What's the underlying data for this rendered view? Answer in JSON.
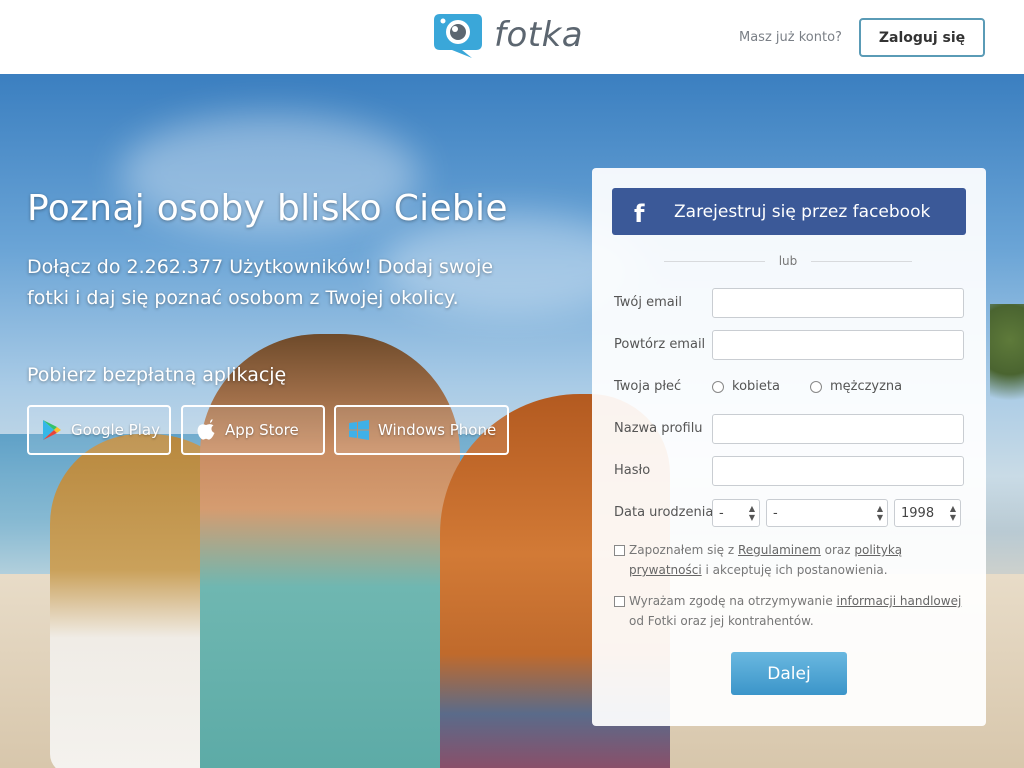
{
  "header": {
    "brand": "fotka",
    "have_account_text": "Masz już konto?",
    "login_label": "Zaloguj się"
  },
  "hero": {
    "title": "Poznaj osoby blisko Ciebie",
    "subtitle": "Dołącz do 2.262.377 Użytkowników! Dodaj swoje fotki i daj się poznać osobom z Twojej okolicy.",
    "app_heading": "Pobierz bezpłatną aplikację",
    "store_buttons": [
      {
        "label": "Google Play",
        "icon": "google-play-icon"
      },
      {
        "label": "App Store",
        "icon": "apple-icon"
      },
      {
        "label": "Windows Phone",
        "icon": "windows-icon"
      }
    ]
  },
  "form": {
    "facebook_label": "Zarejestruj się przez facebook",
    "separator": "lub",
    "email_label": "Twój email",
    "email_repeat_label": "Powtórz email",
    "gender_label": "Twoja płeć",
    "gender_options": [
      "kobieta",
      "mężczyzna"
    ],
    "profile_name_label": "Nazwa profilu",
    "password_label": "Hasło",
    "birthdate_label": "Data urodzenia",
    "birth_day": "-",
    "birth_month": "-",
    "birth_year": "1998",
    "terms_prefix": "Zapoznałem się z",
    "terms_link": "Regulaminem",
    "terms_mid": "oraz",
    "privacy_link": "polityką prywatności",
    "terms_suffix": "i akceptuję ich postanowienia.",
    "marketing_prefix": "Wyrażam zgodę na otrzymywanie",
    "marketing_link": "informacji handlowej",
    "marketing_suffix": "od Fotki oraz jej kontrahentów.",
    "submit_label": "Dalej"
  },
  "colors": {
    "facebook": "#3b5998",
    "submit": "#4aa6d6",
    "login_border": "#5a9bb6"
  }
}
